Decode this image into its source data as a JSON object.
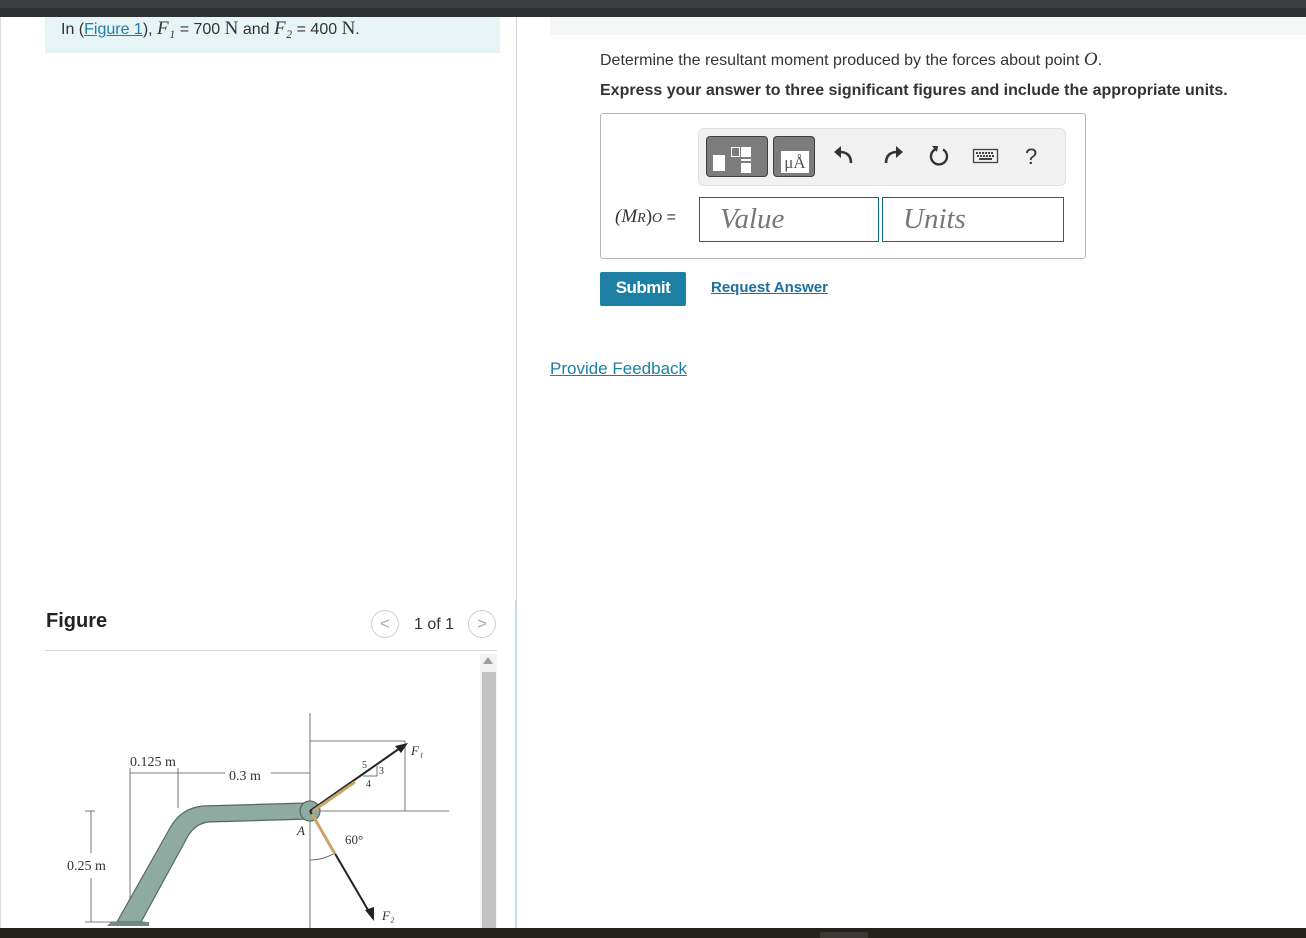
{
  "intro": {
    "prefix": "In (",
    "figure_link": "Figure 1",
    "suffix_a": "), ",
    "f1_symbol": "F₁",
    "f1_value": " = 700 ",
    "unit_n": "N",
    "and_text": " and ",
    "f2_symbol": "F₂",
    "f2_value": " = 400 ",
    "unit_n2": "N",
    "period": "."
  },
  "problem": {
    "question_text": "Determine the resultant moment produced by the forces about point ",
    "point": "O",
    "question_end": ".",
    "instruction": "Express your answer to three significant figures and include the appropriate units."
  },
  "answer": {
    "label_symbol": "(M",
    "label_sub_r": "R",
    "label_close": ")",
    "label_sub_o": "O",
    "label_eq": " =",
    "value_placeholder": "Value",
    "units_placeholder": "Units",
    "toolbar": {
      "units_button_text": "μÅ",
      "help_text": "?",
      "icons": [
        "templates-icon",
        "units-icon",
        "undo-icon",
        "redo-icon",
        "reset-icon",
        "keyboard-icon",
        "help-icon"
      ]
    }
  },
  "actions": {
    "submit": "Submit",
    "request_answer": "Request Answer",
    "provide_feedback": "Provide Feedback"
  },
  "figure": {
    "title": "Figure",
    "pager": "1 of 1",
    "prev_symbol": "<",
    "next_symbol": ">",
    "labels": {
      "d1": "0.125 m",
      "d2": "0.3 m",
      "d3": "0.25 m",
      "angle": "60°",
      "point_a": "A",
      "f1": "F₁",
      "f2": "F₂",
      "tri_5": "5",
      "tri_4": "4",
      "tri_3": "3"
    }
  },
  "colors": {
    "accent": "#1c7fa3",
    "link": "#1b7fa6",
    "intro_bg": "#e6f4f6",
    "pipe": "#8faaa1"
  }
}
